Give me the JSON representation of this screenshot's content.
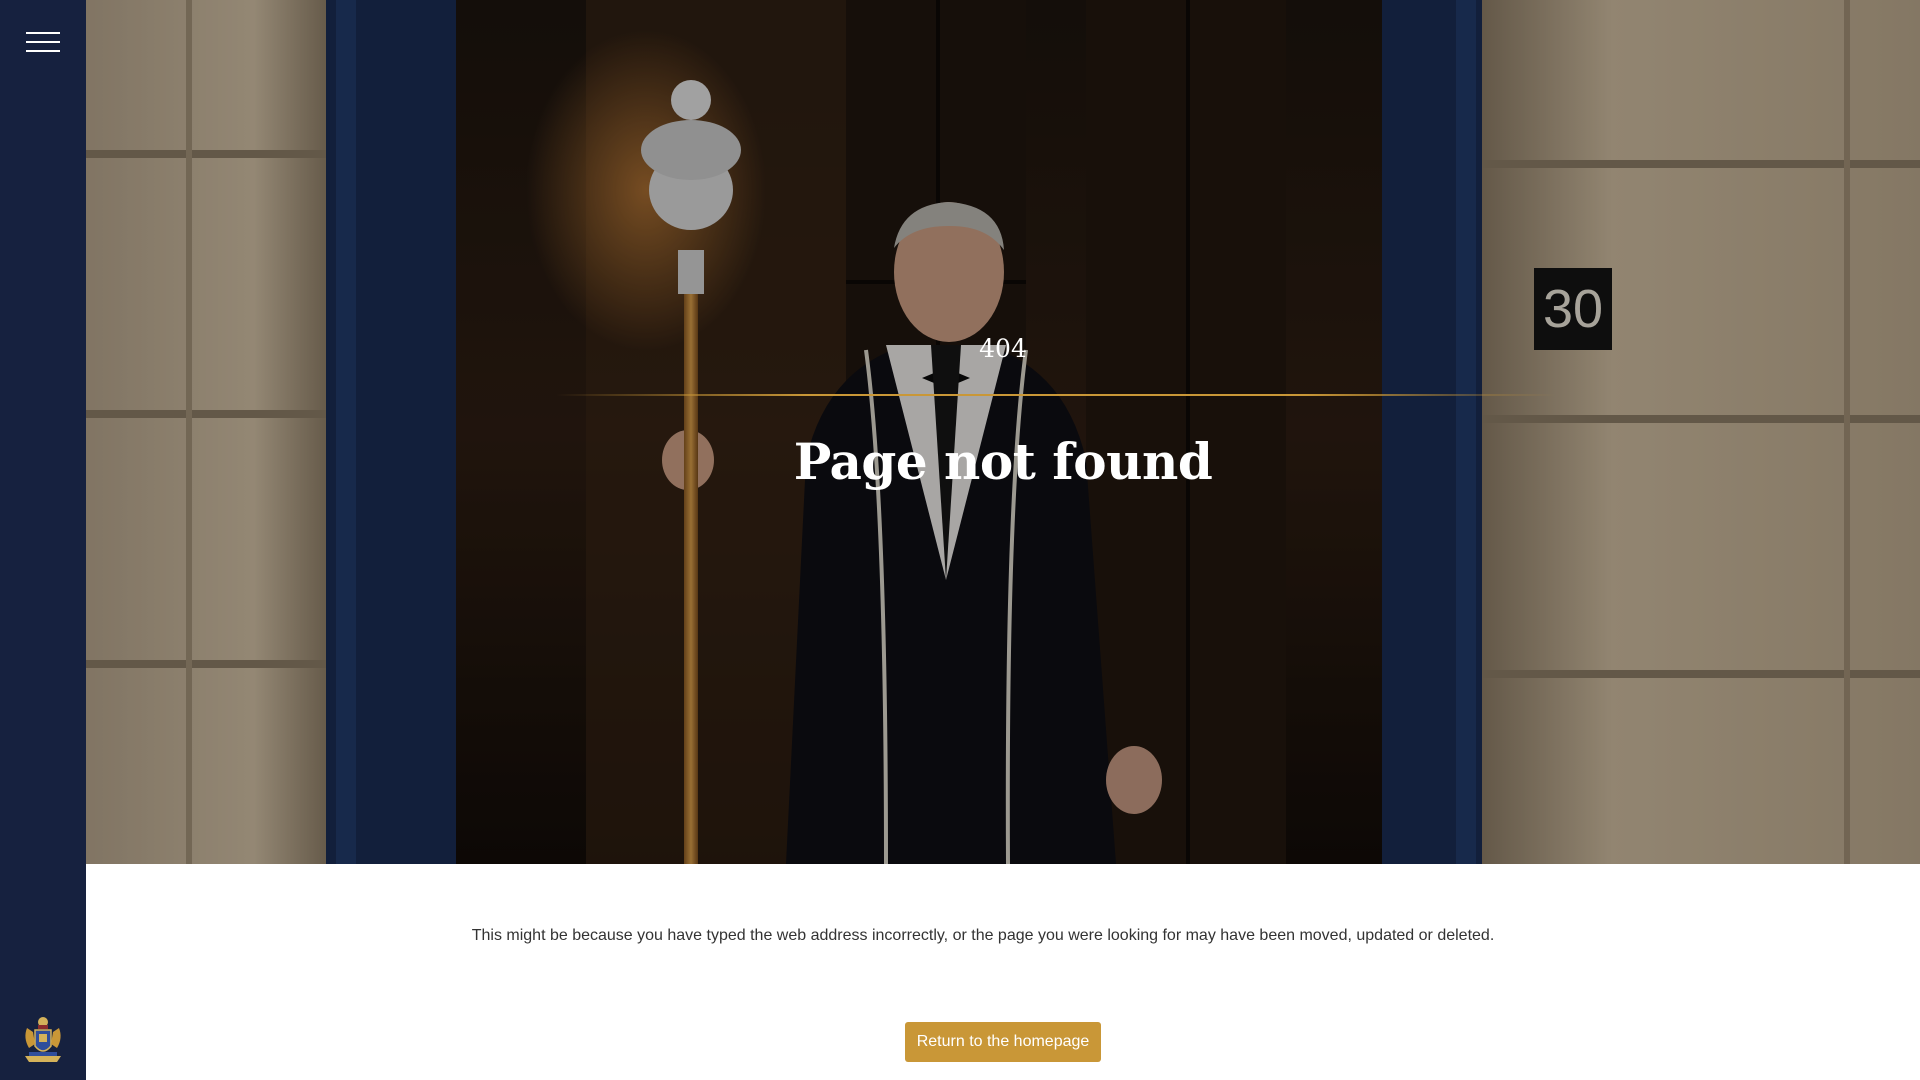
{
  "sidebar": {
    "menu_icon": "hamburger-menu-icon",
    "crest_icon": "coat-of-arms-icon",
    "background": "#16213f"
  },
  "hero": {
    "door_number": "30",
    "error_code": "404",
    "title": "Page not found",
    "accent_color": "#c99737"
  },
  "main": {
    "message": "This might be because you have typed the web address incorrectly, or the page you were looking for may have been moved, updated or deleted.",
    "home_button_label": "Return to the homepage"
  }
}
